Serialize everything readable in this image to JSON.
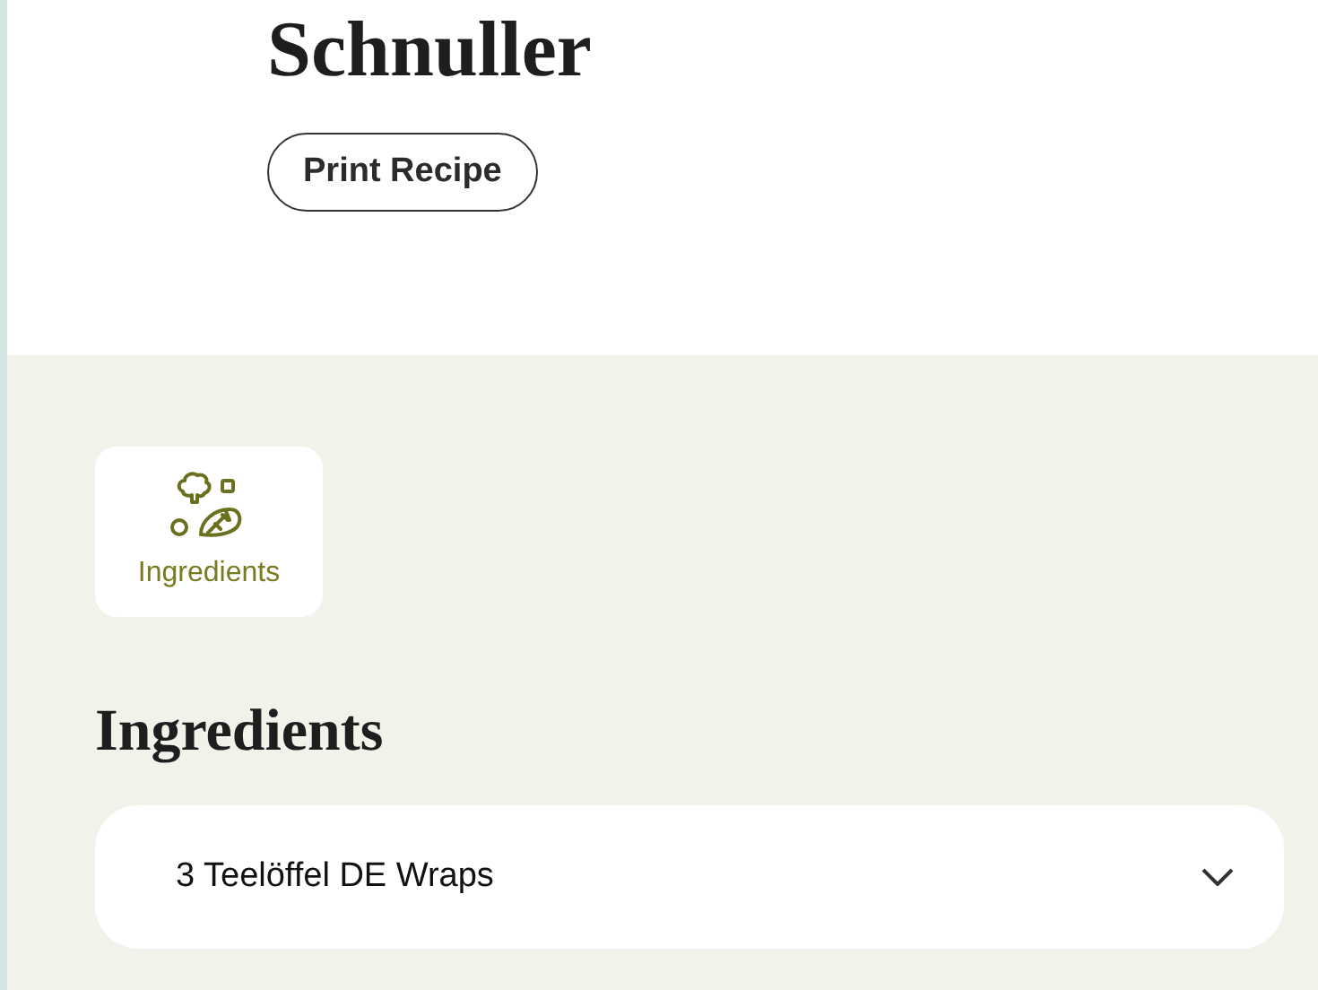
{
  "recipe": {
    "title": "Schnuller",
    "print_button": "Print Recipe"
  },
  "section_tabs": [
    {
      "label": "Ingredients",
      "selected": true
    }
  ],
  "ingredients": {
    "heading": "Ingredients",
    "items": [
      {
        "text": "3 Teelöffel DE Wraps",
        "expanded": false
      }
    ]
  }
}
